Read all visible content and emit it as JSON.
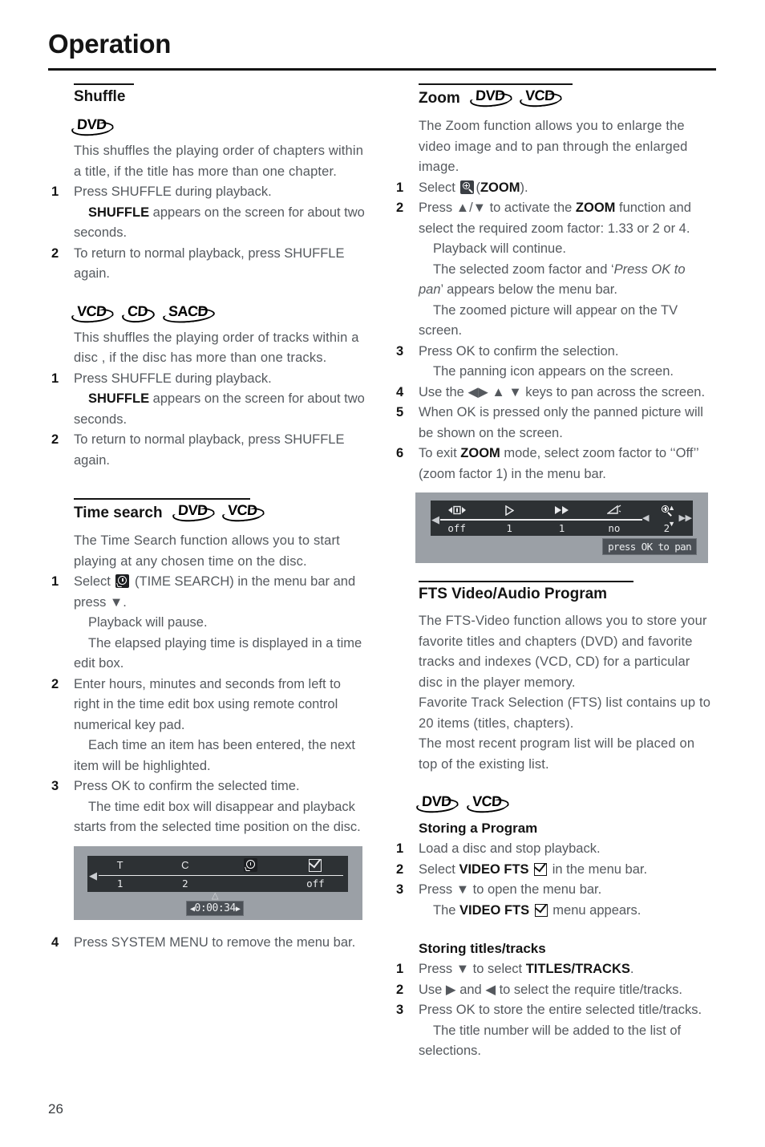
{
  "header": {
    "title": "Operation"
  },
  "footer": {
    "page_number": "26"
  },
  "left": {
    "shuffle": {
      "heading": "Shuffle",
      "discs_1": [
        "DVD"
      ],
      "intro_1": "This shuffles the playing order of chapters within a title, if the title has more than one chapter.",
      "steps_1": [
        {
          "num": "1",
          "text": "Press SHUFFLE during playback."
        },
        {
          "num": "2",
          "text": "To return to normal playback, press SHUFFLE again."
        }
      ],
      "note_1_bold": "SHUFFLE",
      "note_1_rest": " appears on the screen for about two seconds.",
      "discs_2": [
        "VCD",
        "CD",
        "SACD"
      ],
      "intro_2": "This shuffles the playing order of tracks within a disc , if the disc has more than one tracks.",
      "steps_2": [
        {
          "num": "1",
          "text": "Press SHUFFLE during playback."
        },
        {
          "num": "2",
          "text": "To return to normal playback, press SHUFFLE again."
        }
      ],
      "note_2_bold": "SHUFFLE",
      "note_2_rest": " appears on the screen for about two seconds."
    },
    "time_search": {
      "heading": "Time search",
      "discs": [
        "DVD",
        "VCD"
      ],
      "intro": "The Time Search function allows you to start playing at any chosen time on the disc.",
      "step1_pre": "Select ",
      "step1_icon": "time-search-icon",
      "step1_post": " (TIME SEARCH) in the menu bar and press ▼.",
      "step1_note_a": "Playback will pause.",
      "step1_note_b": "The elapsed playing time is displayed in a time edit box.",
      "step2": "Enter hours, minutes and seconds from left to right in the time edit box using remote control numerical key pad.",
      "step2_note": "Each time an item has been entered, the next item will be highlighted.",
      "step3": "Press OK to confirm the selected time.",
      "step3_note": "The time edit box will disappear and playback starts from the selected time position on the disc.",
      "step4": "Press SYSTEM MENU to remove the menu bar.",
      "nums": {
        "n1": "1",
        "n2": "2",
        "n3": "3",
        "n4": "4"
      }
    },
    "time_search_figure": {
      "columns": [
        {
          "icon": "T",
          "value": "1"
        },
        {
          "icon": "C",
          "value": "2"
        },
        {
          "icon": "time-search-icon",
          "value": ""
        },
        {
          "icon": "checkbox-icon",
          "value": "off"
        }
      ],
      "time_value": "0:00:34",
      "left_arrow": "◀",
      "edit_left_arrow": "◀",
      "edit_right_arrow": "▶",
      "up_caret": "△"
    }
  },
  "right": {
    "zoom": {
      "heading": "Zoom",
      "discs": [
        "DVD",
        "VCD"
      ],
      "intro": "The Zoom function allows you to enlarge the video image and to pan through the enlarged image.",
      "step1_pre": "Select ",
      "step1_icon": "zoom-icon",
      "step1_bold": "ZOOM",
      "step1_post": ").",
      "step2_a": "Press ▲/▼ to activate the ",
      "step2_bold": "ZOOM",
      "step2_b": " function and select the required zoom factor: 1.33 or 2 or 4.",
      "step2_note_a": "Playback will continue.",
      "step2_note_b_pre": "The selected zoom factor and ‘",
      "step2_note_b_it": "Press OK to pan",
      "step2_note_b_post": "’ appears below the menu bar.",
      "step2_note_c": "The zoomed picture will appear on the TV screen.",
      "step3": "Press OK to confirm the selection.",
      "step3_note": "The panning icon appears on the screen.",
      "step4": "Use the ◀▶ ▲ ▼ keys to pan across the screen.",
      "step5": "When OK is pressed only the panned picture will be shown on the screen.",
      "step6_a": "To exit ",
      "step6_bold": "ZOOM",
      "step6_b": " mode, select zoom factor to ‘‘Off’’ (zoom factor 1) in the menu bar.",
      "nums": {
        "n1": "1",
        "n2": "2",
        "n3": "3",
        "n4": "4",
        "n5": "5",
        "n6": "6"
      }
    },
    "zoom_figure": {
      "columns": [
        {
          "icon": "repeat-icon",
          "value": "off"
        },
        {
          "icon": "play-icon",
          "value": "1"
        },
        {
          "icon": "fast-forward-icon",
          "value": "1"
        },
        {
          "icon": "angle-icon",
          "value": "no"
        },
        {
          "icon": "zoom-icon",
          "value": "2"
        }
      ],
      "up_arrow": "▲",
      "down_arrow": "▼",
      "left_caret": "◀",
      "right_caret": "▶",
      "far_left_caret": "◀",
      "far_right_caret": "▶",
      "ok_pan_label": "press OK to pan"
    },
    "fts": {
      "heading": "FTS Video/Audio Program",
      "para1": "The FTS-Video function allows you to store your favorite titles and chapters (DVD) and favorite tracks and indexes (VCD, CD) for a particular disc in the player memory.",
      "para2": "Favorite Track Selection (FTS) list contains up to 20 items (titles, chapters).",
      "para3": "The most recent program list will be placed on top of the existing list.",
      "discs": [
        "DVD",
        "VCD"
      ],
      "storing_program_head": "Storing a Program",
      "sp_step1": "Load a disc and stop playback.",
      "sp_step2_pre": "Select ",
      "sp_step2_bold": "VIDEO FTS",
      "sp_step2_post": " in the menu bar.",
      "sp_step3": "Press ▼ to open the menu bar.",
      "sp_step3_note_pre": "The ",
      "sp_step3_note_bold": "VIDEO FTS",
      "sp_step3_note_post": " menu appears.",
      "storing_titles_head": "Storing titles/tracks",
      "st_step1_pre": "Press ▼ to select ",
      "st_step1_bold": "TITLES/TRACKS",
      "st_step1_post": ".",
      "st_step2": "Use ▶ and ◀ to select the require title/tracks.",
      "st_step3": "Press OK to store the entire selected title/tracks.",
      "st_step3_note": "The title number will be added to the list of selections.",
      "nums": {
        "n1": "1",
        "n2": "2",
        "n3": "3"
      }
    }
  }
}
